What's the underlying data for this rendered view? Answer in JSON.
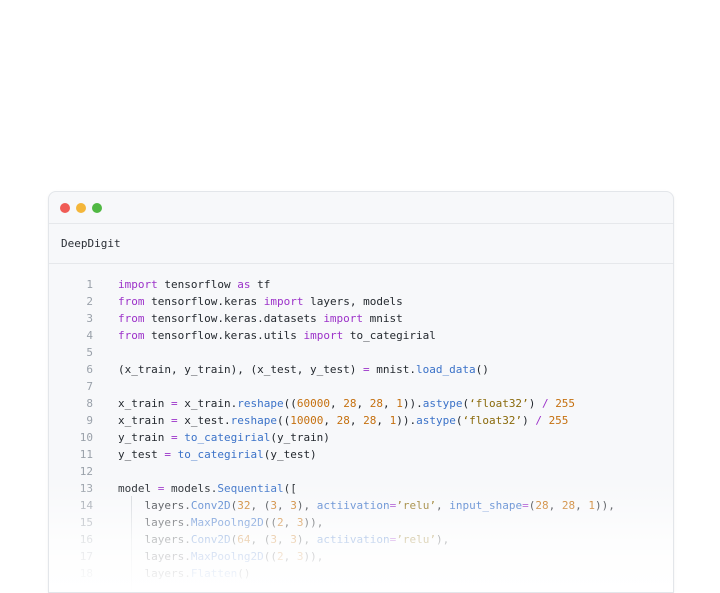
{
  "window": {
    "file_name": "DeepDigit"
  },
  "code_lines": [
    {
      "n": "1",
      "tokens": [
        [
          "kw",
          "import"
        ],
        [
          "p",
          " tensorflow "
        ],
        [
          "kw",
          "as"
        ],
        [
          "p",
          " tf"
        ]
      ]
    },
    {
      "n": "2",
      "tokens": [
        [
          "kw",
          "from"
        ],
        [
          "p",
          " tensorflow.keras "
        ],
        [
          "kw",
          "import"
        ],
        [
          "p",
          " layers, models"
        ]
      ]
    },
    {
      "n": "3",
      "tokens": [
        [
          "kw",
          "from"
        ],
        [
          "p",
          " tensorflow.keras.datasets "
        ],
        [
          "kw",
          "import"
        ],
        [
          "p",
          " mnist"
        ]
      ]
    },
    {
      "n": "4",
      "tokens": [
        [
          "kw",
          "from"
        ],
        [
          "p",
          " tensorflow.keras.utils "
        ],
        [
          "kw",
          "import"
        ],
        [
          "p",
          " to_categirial"
        ]
      ]
    },
    {
      "n": "5",
      "tokens": []
    },
    {
      "n": "6",
      "tokens": [
        [
          "p",
          "(x_train, y_train), (x_test, y_test) "
        ],
        [
          "kw",
          "="
        ],
        [
          "p",
          " mnist."
        ],
        [
          "fn",
          "load_data"
        ],
        [
          "p",
          "()"
        ]
      ]
    },
    {
      "n": "7",
      "tokens": []
    },
    {
      "n": "8",
      "tokens": [
        [
          "p",
          "x_train "
        ],
        [
          "kw",
          "="
        ],
        [
          "p",
          " x_train."
        ],
        [
          "fn",
          "reshape"
        ],
        [
          "p",
          "(("
        ],
        [
          "num",
          "60000"
        ],
        [
          "p",
          ", "
        ],
        [
          "num",
          "28"
        ],
        [
          "p",
          ", "
        ],
        [
          "num",
          "28"
        ],
        [
          "p",
          ", "
        ],
        [
          "num",
          "1"
        ],
        [
          "p",
          "))."
        ],
        [
          "fn",
          "astype"
        ],
        [
          "p",
          "("
        ],
        [
          "str",
          "‘float32’"
        ],
        [
          "p",
          ") "
        ],
        [
          "kw",
          "/"
        ],
        [
          "p",
          " "
        ],
        [
          "num",
          "255"
        ]
      ]
    },
    {
      "n": "9",
      "tokens": [
        [
          "p",
          "x_train "
        ],
        [
          "kw",
          "="
        ],
        [
          "p",
          " x_test."
        ],
        [
          "fn",
          "reshape"
        ],
        [
          "p",
          "(("
        ],
        [
          "num",
          "10000"
        ],
        [
          "p",
          ", "
        ],
        [
          "num",
          "28"
        ],
        [
          "p",
          ", "
        ],
        [
          "num",
          "28"
        ],
        [
          "p",
          ", "
        ],
        [
          "num",
          "1"
        ],
        [
          "p",
          "))."
        ],
        [
          "fn",
          "astype"
        ],
        [
          "p",
          "("
        ],
        [
          "str",
          "‘float32’"
        ],
        [
          "p",
          ") "
        ],
        [
          "kw",
          "/"
        ],
        [
          "p",
          " "
        ],
        [
          "num",
          "255"
        ]
      ]
    },
    {
      "n": "10",
      "tokens": [
        [
          "p",
          "y_train "
        ],
        [
          "kw",
          "="
        ],
        [
          "p",
          " "
        ],
        [
          "fn",
          "to_categirial"
        ],
        [
          "p",
          "(y_train)"
        ]
      ]
    },
    {
      "n": "11",
      "tokens": [
        [
          "p",
          "y_test "
        ],
        [
          "kw",
          "="
        ],
        [
          "p",
          " "
        ],
        [
          "fn",
          "to_categirial"
        ],
        [
          "p",
          "(y_test)"
        ]
      ]
    },
    {
      "n": "12",
      "tokens": []
    },
    {
      "n": "13",
      "tokens": [
        [
          "p",
          "model "
        ],
        [
          "kw",
          "="
        ],
        [
          "p",
          " models."
        ],
        [
          "fn",
          "Sequential"
        ],
        [
          "p",
          "(["
        ]
      ]
    },
    {
      "n": "14",
      "tokens": [
        [
          "p",
          "    layers."
        ],
        [
          "fn",
          "Conv2D"
        ],
        [
          "p",
          "("
        ],
        [
          "num",
          "32"
        ],
        [
          "p",
          ", ("
        ],
        [
          "num",
          "3"
        ],
        [
          "p",
          ", "
        ],
        [
          "num",
          "3"
        ],
        [
          "p",
          "), "
        ],
        [
          "fn",
          "actiivation"
        ],
        [
          "kw",
          "="
        ],
        [
          "str",
          "’relu’"
        ],
        [
          "p",
          ", "
        ],
        [
          "fn",
          "input_shape"
        ],
        [
          "kw",
          "="
        ],
        [
          "p",
          "("
        ],
        [
          "num",
          "28"
        ],
        [
          "p",
          ", "
        ],
        [
          "num",
          "28"
        ],
        [
          "p",
          ", "
        ],
        [
          "num",
          "1"
        ],
        [
          "p",
          ")),"
        ]
      ]
    },
    {
      "n": "15",
      "tokens": [
        [
          "p",
          "    layers."
        ],
        [
          "fn",
          "MaxPoolng2D"
        ],
        [
          "p",
          "(("
        ],
        [
          "num",
          "2"
        ],
        [
          "p",
          ", "
        ],
        [
          "num",
          "3"
        ],
        [
          "p",
          ")),"
        ]
      ]
    },
    {
      "n": "16",
      "tokens": [
        [
          "p",
          "    layers."
        ],
        [
          "fn",
          "Conv2D"
        ],
        [
          "p",
          "("
        ],
        [
          "num",
          "64"
        ],
        [
          "p",
          ", ("
        ],
        [
          "num",
          "3"
        ],
        [
          "p",
          ", "
        ],
        [
          "num",
          "3"
        ],
        [
          "p",
          "), "
        ],
        [
          "fn",
          "actiivation"
        ],
        [
          "kw",
          "="
        ],
        [
          "str",
          "’relu’"
        ],
        [
          "p",
          "),"
        ]
      ]
    },
    {
      "n": "17",
      "tokens": [
        [
          "p",
          "    layers."
        ],
        [
          "fn",
          "MaxPoolng2D"
        ],
        [
          "p",
          "(("
        ],
        [
          "num",
          "2"
        ],
        [
          "p",
          ", "
        ],
        [
          "num",
          "3"
        ],
        [
          "p",
          ")),"
        ]
      ]
    },
    {
      "n": "18",
      "tokens": [
        [
          "p",
          "    layers."
        ],
        [
          "fn",
          "Flatten"
        ],
        [
          "p",
          "()"
        ]
      ]
    }
  ]
}
